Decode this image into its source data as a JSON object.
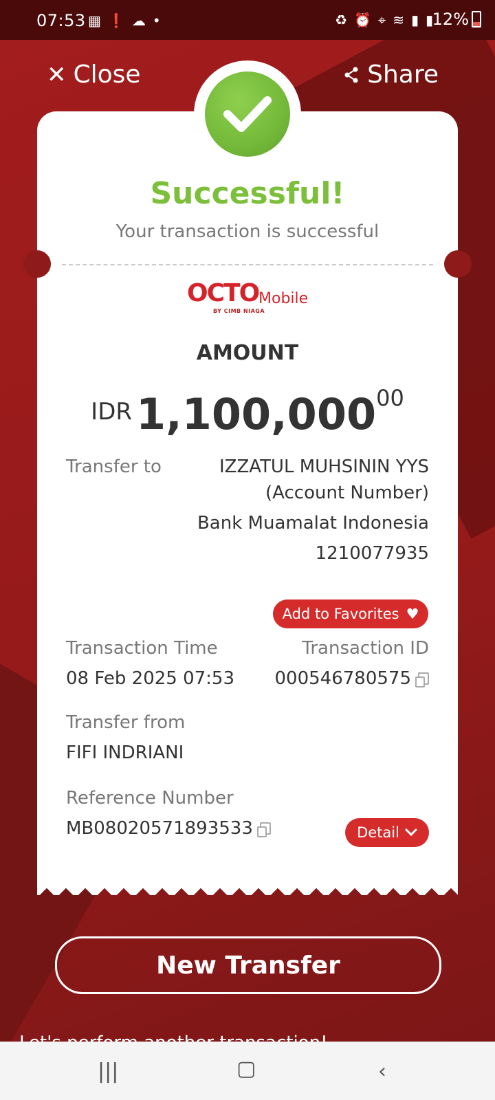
{
  "status": {
    "time": "07:53",
    "battery": "12%"
  },
  "topbar": {
    "close_label": "Close",
    "share_label": "Share"
  },
  "result": {
    "title": "Successful!",
    "subtitle": "Your transaction is successful"
  },
  "brand": {
    "logo_main": "OCTO",
    "logo_sub": "Mobile",
    "logo_byline": "BY CIMB NIAGA"
  },
  "amount": {
    "label": "AMOUNT",
    "currency": "IDR",
    "value": "1,100,000",
    "decimals": "00"
  },
  "transfer_to": {
    "label": "Transfer to",
    "name": "IZZATUL MUHSININ YYS",
    "account_type": "(Account Number)",
    "bank": "Bank Muamalat Indonesia",
    "account_number": "1210077935"
  },
  "favorites_button": "Add to Favorites",
  "transaction_time": {
    "label": "Transaction Time",
    "value": "08 Feb 2025 07:53"
  },
  "transaction_id": {
    "label": "Transaction ID",
    "value": "000546780575"
  },
  "transfer_from": {
    "label": "Transfer from",
    "value": "FIFI INDRIANI"
  },
  "reference": {
    "label": "Reference Number",
    "value": "MB08020571893533"
  },
  "detail_button": "Detail",
  "new_transfer_button": "New Transfer",
  "footer_hint": "Let's perform another transaction!",
  "colors": {
    "brand_red": "#d52b2b",
    "success_green": "#7cbf3a",
    "background": "#8e1a1a"
  }
}
